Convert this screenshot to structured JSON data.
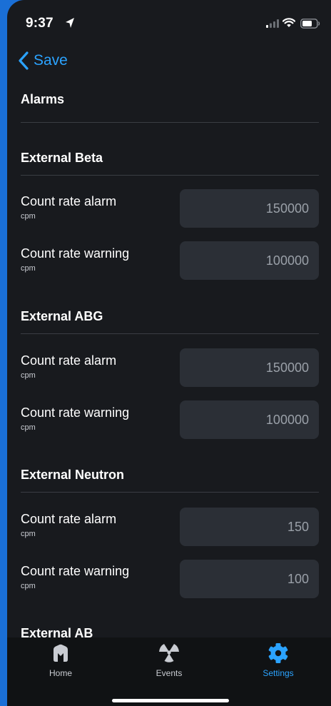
{
  "status_bar": {
    "time": "9:37"
  },
  "nav": {
    "back_label": "Save"
  },
  "page": {
    "title": "Alarms"
  },
  "sections": [
    {
      "title": "External Beta",
      "rows": [
        {
          "label": "Count rate alarm",
          "unit": "cpm",
          "value": "150000"
        },
        {
          "label": "Count rate warning",
          "unit": "cpm",
          "value": "100000"
        }
      ]
    },
    {
      "title": "External ABG",
      "rows": [
        {
          "label": "Count rate alarm",
          "unit": "cpm",
          "value": "150000"
        },
        {
          "label": "Count rate warning",
          "unit": "cpm",
          "value": "100000"
        }
      ]
    },
    {
      "title": "External Neutron",
      "rows": [
        {
          "label": "Count rate alarm",
          "unit": "cpm",
          "value": "150"
        },
        {
          "label": "Count rate warning",
          "unit": "cpm",
          "value": "100"
        }
      ]
    },
    {
      "title": "External AB",
      "rows": []
    }
  ],
  "tabs": [
    {
      "label": "Home",
      "icon": "home-logo-icon",
      "active": false
    },
    {
      "label": "Events",
      "icon": "radiation-icon",
      "active": false
    },
    {
      "label": "Settings",
      "icon": "gear-icon",
      "active": true
    }
  ],
  "colors": {
    "accent": "#2ba3ff",
    "background": "#181a1e",
    "field": "#2b2f36",
    "frame": "#1a6fd6"
  }
}
